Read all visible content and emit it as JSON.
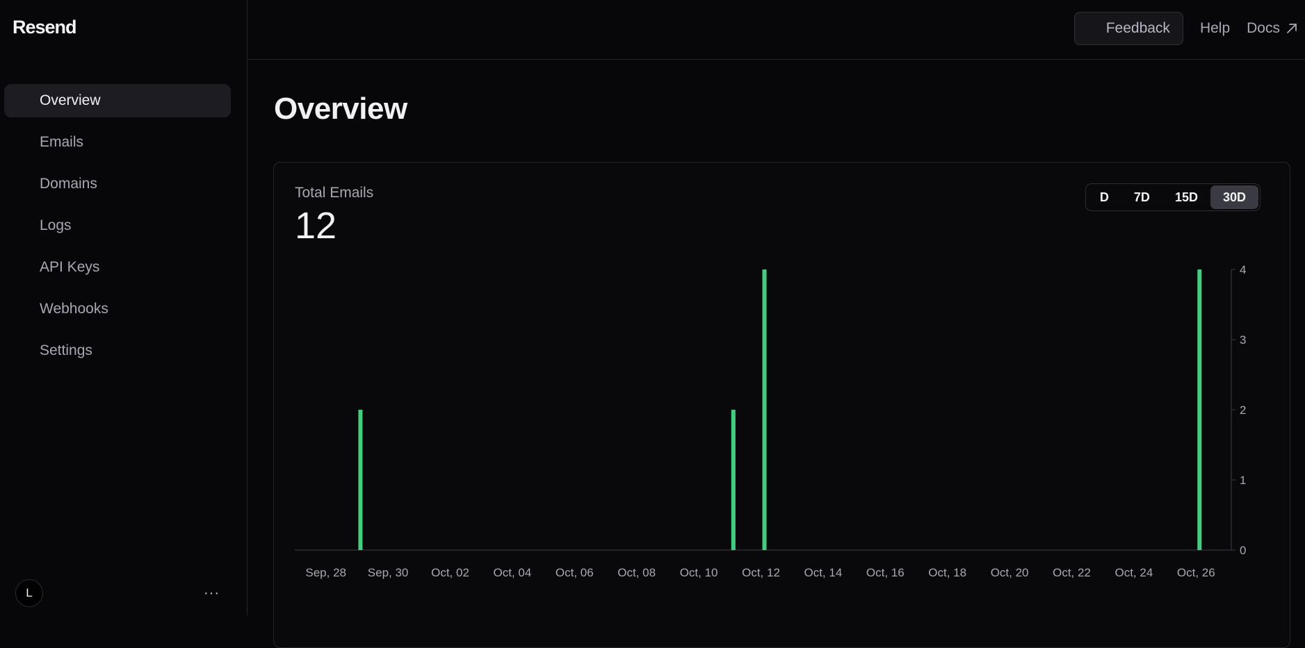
{
  "app": {
    "name": "Resend"
  },
  "sidebar": {
    "items": [
      {
        "label": "Overview",
        "active": true
      },
      {
        "label": "Emails"
      },
      {
        "label": "Domains"
      },
      {
        "label": "Logs"
      },
      {
        "label": "API Keys"
      },
      {
        "label": "Webhooks"
      },
      {
        "label": "Settings"
      }
    ],
    "user_initial": "L",
    "more_label": "···"
  },
  "topbar": {
    "feedback": "Feedback",
    "help": "Help",
    "docs": "Docs"
  },
  "page": {
    "title": "Overview"
  },
  "metric": {
    "label": "Total Emails",
    "value": "12"
  },
  "ranges": [
    {
      "label": "D"
    },
    {
      "label": "7D"
    },
    {
      "label": "15D"
    },
    {
      "label": "30D",
      "active": true
    }
  ],
  "colors": {
    "bar": "#3ecf7f",
    "background": "#07070a"
  },
  "chart_data": {
    "type": "bar",
    "x": [
      "Sep 29",
      "Oct 11",
      "Oct 12",
      "Oct 26"
    ],
    "values": [
      2,
      2,
      4,
      4
    ],
    "x_tick_labels": [
      "Sep, 28",
      "Sep, 30",
      "Oct, 02",
      "Oct, 04",
      "Oct, 06",
      "Oct, 08",
      "Oct, 10",
      "Oct, 12",
      "Oct, 14",
      "Oct, 16",
      "Oct, 18",
      "Oct, 20",
      "Oct, 22",
      "Oct, 24",
      "Oct, 26"
    ],
    "y_ticks": [
      0,
      1,
      2,
      3,
      4
    ],
    "ylim": [
      0,
      4
    ],
    "xlim": [
      "Sep 27",
      "Oct 27"
    ],
    "grid": false,
    "legend": "none"
  }
}
